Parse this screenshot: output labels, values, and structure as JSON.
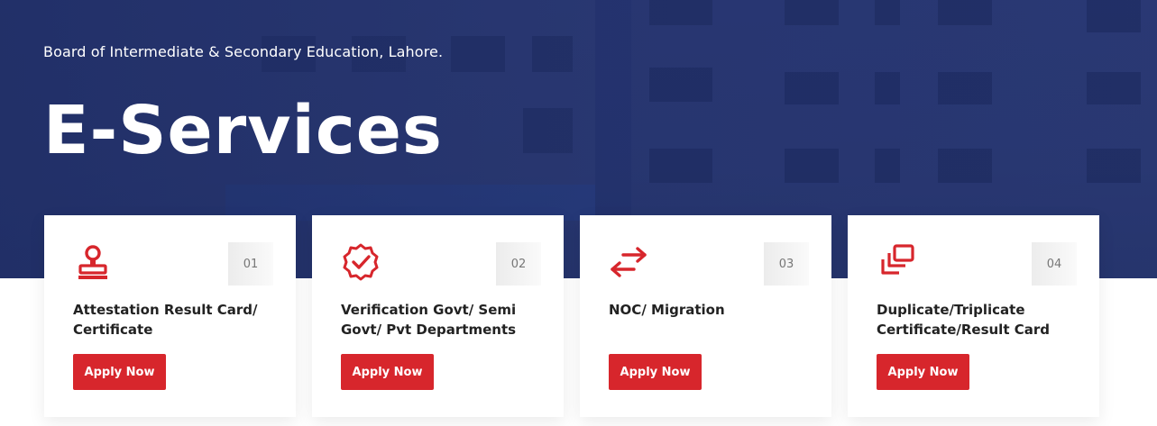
{
  "hero": {
    "subtitle": "Board of Intermediate & Secondary Education, Lahore.",
    "title": "E-Services"
  },
  "colors": {
    "hero_blue": "#2a3a78",
    "accent_red": "#d7262c",
    "text_dark": "#222222"
  },
  "cards": [
    {
      "number": "01",
      "title": "Attestation Result Card/ Certificate",
      "button": "Apply Now",
      "icon": "stamp-icon"
    },
    {
      "number": "02",
      "title": "Verification Govt/ Semi Govt/ Pvt Departments",
      "button": "Apply Now",
      "icon": "verified-badge-icon"
    },
    {
      "number": "03",
      "title": "NOC/ Migration",
      "button": "Apply Now",
      "icon": "swap-arrows-icon"
    },
    {
      "number": "04",
      "title": "Duplicate/Triplicate Certificate/Result Card",
      "button": "Apply Now",
      "icon": "copies-icon"
    }
  ]
}
